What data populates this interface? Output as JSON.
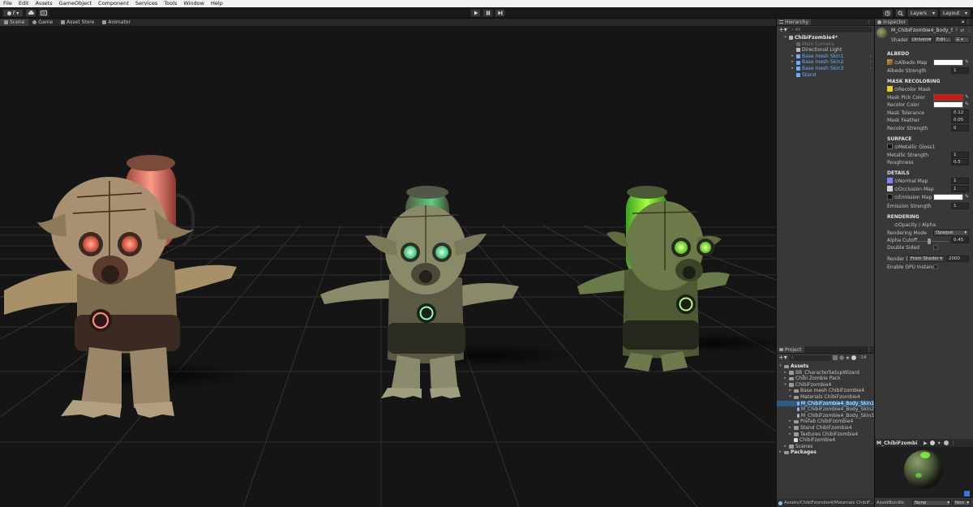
{
  "menubar": [
    "File",
    "Edit",
    "Assets",
    "GameObject",
    "Component",
    "Services",
    "Tools",
    "Window",
    "Help"
  ],
  "toolbar": {
    "account_label": "F",
    "layers_label": "Layers",
    "layout_label": "Layout"
  },
  "scene_tabs": [
    "Scene",
    "Game",
    "Asset Store",
    "Animator"
  ],
  "hierarchy": {
    "title": "Hierarchy",
    "search_placeholder": "All",
    "items": [
      {
        "label": "ChibiFzombie4*",
        "indent": 0,
        "arrow": "▾",
        "style": "bold"
      },
      {
        "label": "Main Camera",
        "indent": 1,
        "arrow": "",
        "style": "dim"
      },
      {
        "label": "Directional Light",
        "indent": 1,
        "arrow": "",
        "style": "normal"
      },
      {
        "label": "Base mesh Skin1",
        "indent": 1,
        "arrow": "▸",
        "style": "blue"
      },
      {
        "label": "Base mesh Skin2",
        "indent": 1,
        "arrow": "▸",
        "style": "blue"
      },
      {
        "label": "Base mesh Skin3",
        "indent": 1,
        "arrow": "▸",
        "style": "blue"
      },
      {
        "label": "Stand",
        "indent": 1,
        "arrow": "",
        "style": "blue"
      }
    ]
  },
  "project": {
    "title": "Project",
    "count_badge": "14",
    "items": [
      {
        "label": "Assets",
        "indent": 0,
        "arrow": "▾",
        "bold": true,
        "selected": false,
        "icon": "folder"
      },
      {
        "label": "BB_CharacterSetupWizard",
        "indent": 1,
        "arrow": "▸",
        "bold": false,
        "selected": false,
        "icon": "folder"
      },
      {
        "label": "Chibi Zombie Pack",
        "indent": 1,
        "arrow": "▸",
        "bold": false,
        "selected": false,
        "icon": "folder"
      },
      {
        "label": "ChibiFzombie4",
        "indent": 1,
        "arrow": "▾",
        "bold": false,
        "selected": false,
        "icon": "folder"
      },
      {
        "label": "Base mesh ChibiFzombie4",
        "indent": 2,
        "arrow": "▸",
        "bold": false,
        "selected": false,
        "icon": "folder"
      },
      {
        "label": "Materials ChibiFzombie4",
        "indent": 2,
        "arrow": "▾",
        "bold": false,
        "selected": false,
        "icon": "folder"
      },
      {
        "label": "M_ChibiFzombie4_Body_Skin1",
        "indent": 3,
        "arrow": "",
        "bold": false,
        "selected": true,
        "icon": "material"
      },
      {
        "label": "M_ChibiFzombie4_Body_Skin2",
        "indent": 3,
        "arrow": "",
        "bold": false,
        "selected": false,
        "icon": "material"
      },
      {
        "label": "M_ChibiFzombie4_Body_Skin3",
        "indent": 3,
        "arrow": "",
        "bold": false,
        "selected": false,
        "icon": "material"
      },
      {
        "label": "Prefab ChibiFzombie4",
        "indent": 2,
        "arrow": "▸",
        "bold": false,
        "selected": false,
        "icon": "folder"
      },
      {
        "label": "Stand ChibiFzombie4",
        "indent": 2,
        "arrow": "▸",
        "bold": false,
        "selected": false,
        "icon": "folder"
      },
      {
        "label": "Textures ChibiFzombie4",
        "indent": 2,
        "arrow": "▸",
        "bold": false,
        "selected": false,
        "icon": "folder"
      },
      {
        "label": "ChibiFzombie4",
        "indent": 2,
        "arrow": "",
        "bold": false,
        "selected": false,
        "icon": "prefab"
      },
      {
        "label": "Scenes",
        "indent": 1,
        "arrow": "▸",
        "bold": false,
        "selected": false,
        "icon": "folder"
      },
      {
        "label": "Packages",
        "indent": 0,
        "arrow": "▸",
        "bold": true,
        "selected": false,
        "icon": "folder"
      }
    ],
    "path": "Assets/ChibiFzombie4/Materials ChibiF..."
  },
  "inspector": {
    "title": "Inspector",
    "material_name": "M_ChibiFzombie4_Body_S",
    "shader_label": "Shader",
    "shader_value": "Univers▾",
    "edit_label": "Edit...",
    "albedo": {
      "title": "ALBEDO",
      "albedo_map": "Albedo Map",
      "albedo_strength": "Albedo Strength",
      "albedo_strength_value": "1"
    },
    "mask": {
      "title": "MASK RECOLORING",
      "recolor_mask": "Recolor Mask",
      "mask_pick_color": "Mask Pick Color",
      "recolor_color": "Recolor Color",
      "mask_tolerance": "Mask Tolerance",
      "mask_tolerance_value": "0.12",
      "mask_feather": "Mask Feather",
      "mask_feather_value": "0.05",
      "recolor_strength": "Recolor Strength",
      "recolor_strength_value": "0"
    },
    "surface": {
      "title": "SURFACE",
      "metallic_gloss": "Metallic Gloss1",
      "metallic_strength": "Metallic Strength",
      "metallic_strength_value": "1",
      "roughness": "Roughness",
      "roughness_value": "0.5"
    },
    "details": {
      "title": "DETAILS",
      "normal_map": "Normal Map",
      "normal_map_value": "1",
      "occlusion_map": "Occlusion Map",
      "occlusion_map_value": "1",
      "emission_map": "Emission Map",
      "emission_strength": "Emission Strength",
      "emission_strength_value": "1"
    },
    "rendering": {
      "title": "RENDERING",
      "opacity_alpha": "Opacity / Alpha",
      "rendering_mode": "Rendering Mode",
      "rendering_mode_value": "Opaque",
      "alpha_cutoff": "Alpha Cutoff",
      "alpha_cutoff_value": "0.45",
      "double_sided": "Double Sided",
      "render_queue": "Render Q",
      "render_queue_mode": "From Shader",
      "render_queue_value": "2000",
      "gpu_instancing": "Enable GPU Instanci"
    },
    "preview_title": "M_ChibiFzombi",
    "asset_bundle_label": "AssetBundle",
    "asset_bundle_value": "None",
    "asset_bundle_variant": "Non"
  },
  "colors": {
    "mask_pick_color": "#e01010",
    "recolor_color": "#ffffff",
    "albedo_color": "#ffffff",
    "emission_color": "#ffffff",
    "selection": "#2c5d87",
    "link_blue": "#6ab0ff"
  },
  "icons": [
    "play-icon",
    "pause-icon",
    "step-icon",
    "history-icon",
    "search-icon",
    "lock-icon",
    "kebab-icon",
    "cloud-icon"
  ]
}
